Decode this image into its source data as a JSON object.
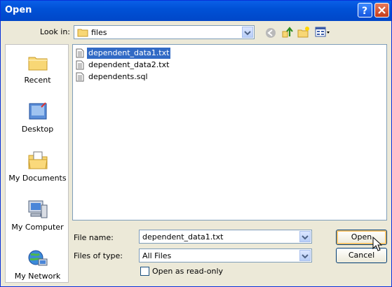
{
  "window": {
    "title": "Open"
  },
  "toolbar": {
    "look_in_label": "Look in:",
    "look_in_value": "files"
  },
  "sidebar": {
    "items": [
      {
        "label": "Recent"
      },
      {
        "label": "Desktop"
      },
      {
        "label": "My Documents"
      },
      {
        "label": "My Computer"
      },
      {
        "label": "My Network"
      }
    ]
  },
  "files": [
    {
      "name": "dependent_data1.txt",
      "selected": true
    },
    {
      "name": "dependent_data2.txt",
      "selected": false
    },
    {
      "name": "dependents.sql",
      "selected": false
    }
  ],
  "form": {
    "file_name_label": "File name:",
    "file_name_value": "dependent_data1.txt",
    "file_type_label": "Files of type:",
    "file_type_value": "All Files",
    "readonly_label": "Open as read-only"
  },
  "buttons": {
    "open": "Open",
    "cancel": "Cancel"
  }
}
